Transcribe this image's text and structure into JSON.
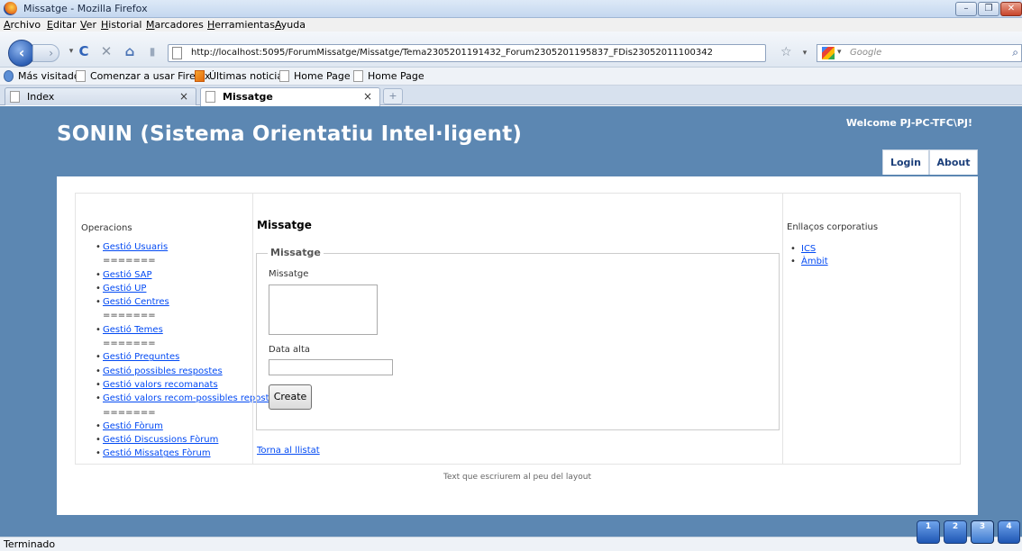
{
  "window": {
    "title": "Missatge - Mozilla Firefox"
  },
  "menu": [
    "Archivo",
    "Editar",
    "Ver",
    "Historial",
    "Marcadores",
    "Herramientas",
    "Ayuda"
  ],
  "nav": {
    "url": "http://localhost:5095/ForumMissatge/Missatge/Tema2305201191432_Forum2305201195837_FDis23052011100342",
    "search_placeholder": "Google"
  },
  "bookmarks": [
    "Más visitados",
    "Comenzar a usar Firefox",
    "Últimas noticias",
    "Home Page",
    "Home Page"
  ],
  "tabs": [
    {
      "label": "Index"
    },
    {
      "label": "Missatge"
    }
  ],
  "site": {
    "title": "SONIN (Sistema Orientatiu Intel·ligent)",
    "welcome": "Welcome PJ-PC-TFC\\PJ!",
    "menu": [
      "Login",
      "About"
    ]
  },
  "left": {
    "title": "Operacions",
    "items": [
      {
        "text": "Gestió Usuaris",
        "link": true
      },
      {
        "text": "=======",
        "link": false
      },
      {
        "text": "Gestió SAP",
        "link": true
      },
      {
        "text": "Gestió UP",
        "link": true
      },
      {
        "text": "Gestió Centres",
        "link": true
      },
      {
        "text": "=======",
        "link": false
      },
      {
        "text": "Gestió Temes",
        "link": true
      },
      {
        "text": "=======",
        "link": false
      },
      {
        "text": "Gestió Preguntes",
        "link": true
      },
      {
        "text": "Gestió possibles respostes",
        "link": true
      },
      {
        "text": "Gestió valors recomanats",
        "link": true
      },
      {
        "text": "Gestió valors recom-possibles repostes",
        "link": true
      },
      {
        "text": "=======",
        "link": false
      },
      {
        "text": "Gestió Fòrum",
        "link": true
      },
      {
        "text": "Gestió Discussions Fòrum",
        "link": true
      },
      {
        "text": "Gestió Missatges Fòrum",
        "link": true
      }
    ]
  },
  "center": {
    "title": "Missatge",
    "legend": "Missatge",
    "message_label": "Missatge",
    "date_label": "Data alta",
    "create_button": "Create",
    "back_link": "Torna al llistat"
  },
  "right": {
    "title": "Enllaços corporatius",
    "links": [
      "ICS",
      "Àmbit"
    ]
  },
  "footer": "Text que escriurem al peu del layout",
  "status": "Terminado",
  "desktops": [
    "1",
    "2",
    "3",
    "4"
  ]
}
